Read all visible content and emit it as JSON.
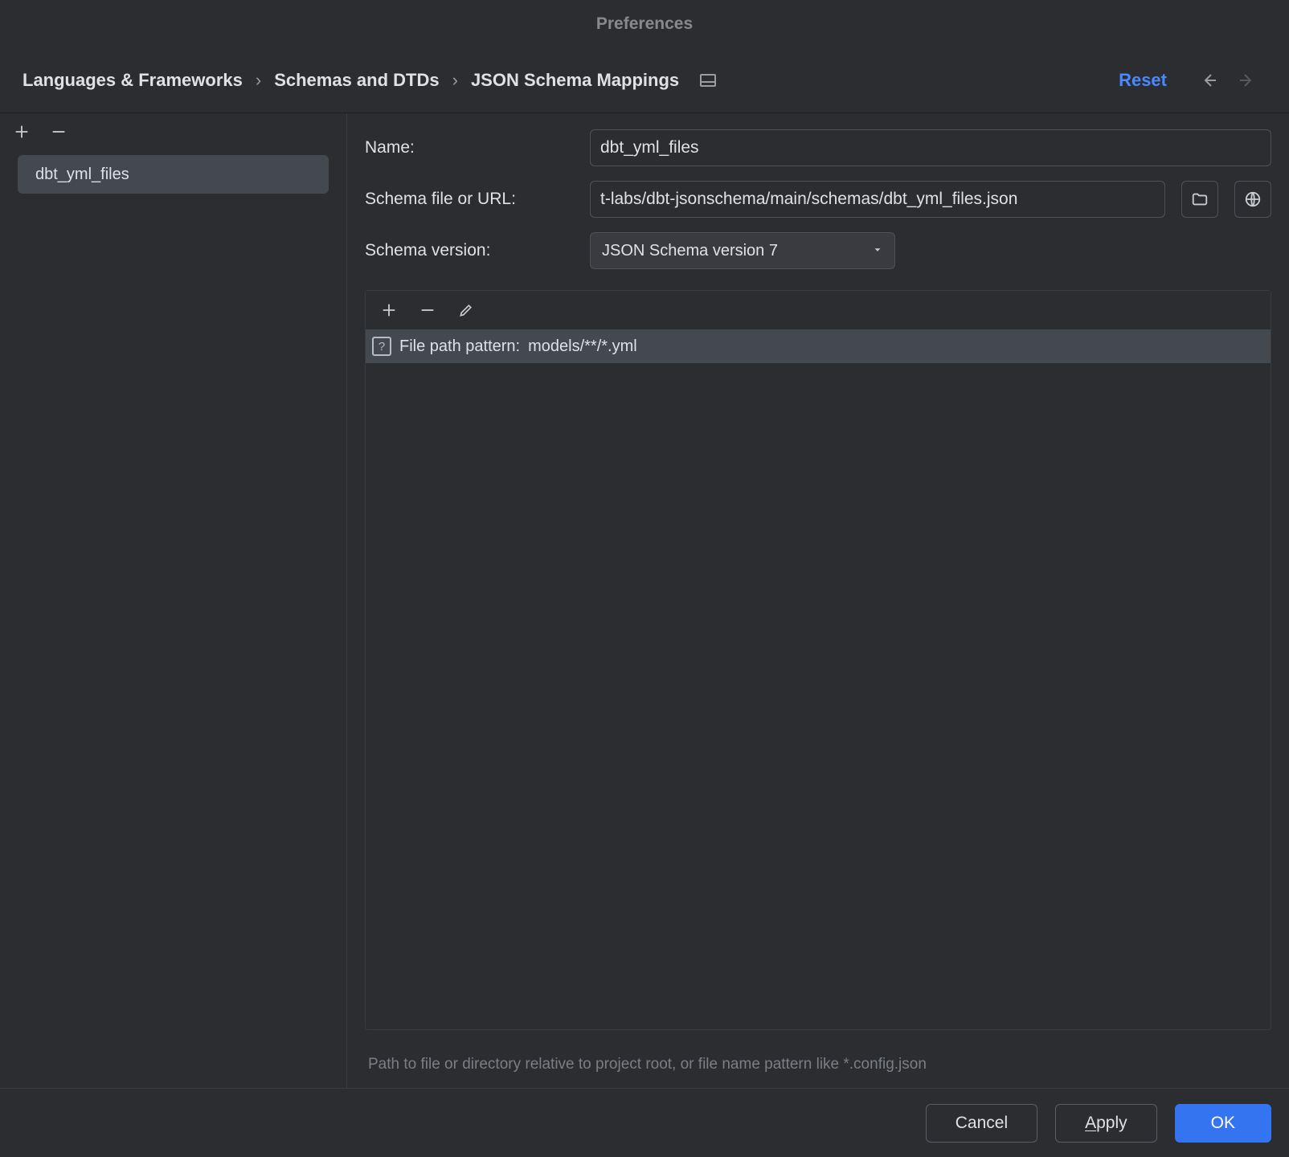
{
  "window": {
    "title": "Preferences"
  },
  "breadcrumbs": {
    "items": [
      "Languages & Frameworks",
      "Schemas and DTDs",
      "JSON Schema Mappings"
    ]
  },
  "header": {
    "reset": "Reset"
  },
  "sidebar": {
    "items": [
      {
        "label": "dbt_yml_files"
      }
    ]
  },
  "form": {
    "name_label": "Name:",
    "name_value": "dbt_yml_files",
    "schema_file_label": "Schema file or URL:",
    "schema_file_value": "t-labs/dbt-jsonschema/main/schemas/dbt_yml_files.json",
    "schema_version_label": "Schema version:",
    "schema_version_value": "JSON Schema version 7"
  },
  "patterns": {
    "items": [
      {
        "prefix": "File path pattern:",
        "value": "models/**/*.yml"
      }
    ],
    "hint": "Path to file or directory relative to project root, or file name pattern like *.config.json"
  },
  "footer": {
    "cancel": "Cancel",
    "apply_prefix": "A",
    "apply_rest": "pply",
    "ok": "OK"
  },
  "icons": {
    "plus": "plus-icon",
    "minus": "minus-icon",
    "pencil": "pencil-icon",
    "folder": "folder-icon",
    "globe": "globe-icon",
    "chevron_down": "chevron-down-icon",
    "arrow_left": "arrow-left-icon",
    "arrow_right": "arrow-right-icon"
  }
}
